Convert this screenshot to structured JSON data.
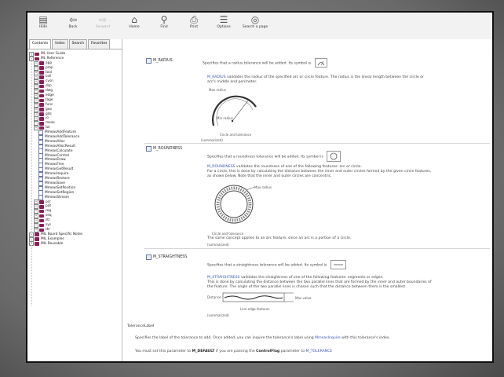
{
  "toolbar": {
    "buttons": [
      {
        "label": "Hide",
        "icon": "hide-icon"
      },
      {
        "label": "Back",
        "icon": "back-icon"
      },
      {
        "label": "Forward",
        "icon": "forward-icon"
      },
      {
        "label": "Home",
        "icon": "home-icon"
      },
      {
        "label": "Find",
        "icon": "find-icon"
      },
      {
        "label": "Print",
        "icon": "print-icon"
      },
      {
        "label": "Options",
        "icon": "options-icon"
      },
      {
        "label": "Search a page",
        "icon": "search-page-icon"
      }
    ]
  },
  "sidebar": {
    "tabs": [
      "Contents",
      "Index",
      "Search",
      "Favorites"
    ],
    "active_tab": "Contents",
    "tree": [
      {
        "label": "ML User Guide",
        "kind": "book",
        "depth": 0
      },
      {
        "label": "ML Reference",
        "kind": "book",
        "depth": 0
      },
      {
        "label": "app",
        "kind": "book",
        "depth": 1
      },
      {
        "label": "prop",
        "kind": "book",
        "depth": 1
      },
      {
        "label": "tool",
        "kind": "book",
        "depth": 1
      },
      {
        "label": "cell",
        "kind": "book",
        "depth": 1
      },
      {
        "label": "cvsn",
        "kind": "book",
        "depth": 1
      },
      {
        "label": "dsp",
        "kind": "book",
        "depth": 1
      },
      {
        "label": "dwg",
        "kind": "book",
        "depth": 1
      },
      {
        "label": "edge",
        "kind": "book",
        "depth": 1
      },
      {
        "label": "fage",
        "kind": "book",
        "depth": 1
      },
      {
        "label": "func",
        "kind": "book",
        "depth": 1
      },
      {
        "label": "geo",
        "kind": "book",
        "depth": 1
      },
      {
        "label": "gds",
        "kind": "book",
        "depth": 1
      },
      {
        "label": "io",
        "kind": "book",
        "depth": 1
      },
      {
        "label": "meas",
        "kind": "book",
        "depth": 1
      },
      {
        "label": "tol",
        "kind": "book",
        "depth": 1
      },
      {
        "label": "MmeasAddFeature",
        "kind": "page",
        "depth": 2
      },
      {
        "label": "MmeasAddTolerance",
        "kind": "page",
        "depth": 2
      },
      {
        "label": "MmeasAlloc",
        "kind": "page",
        "depth": 2
      },
      {
        "label": "MmeasAllocResult",
        "kind": "page",
        "depth": 2
      },
      {
        "label": "MmeasCalculate",
        "kind": "page",
        "depth": 2
      },
      {
        "label": "MmeasControl",
        "kind": "page",
        "depth": 2
      },
      {
        "label": "MmeasDraw",
        "kind": "page",
        "depth": 2
      },
      {
        "label": "MmeasFree",
        "kind": "page",
        "depth": 2
      },
      {
        "label": "MmeasGetResult",
        "kind": "page",
        "depth": 2
      },
      {
        "label": "MmeasInquire",
        "kind": "page",
        "depth": 2
      },
      {
        "label": "MmeasRestore",
        "kind": "page",
        "depth": 2
      },
      {
        "label": "MmeasSave",
        "kind": "page",
        "depth": 2
      },
      {
        "label": "MmeasSetPosition",
        "kind": "page",
        "depth": 2
      },
      {
        "label": "MmeasSetRegion",
        "kind": "page",
        "depth": 2
      },
      {
        "label": "MmeasStream",
        "kind": "page",
        "depth": 2
      },
      {
        "label": "ocr",
        "kind": "book",
        "depth": 1
      },
      {
        "label": "pat",
        "kind": "book",
        "depth": 1
      },
      {
        "label": "reg",
        "kind": "book",
        "depth": 1
      },
      {
        "label": "seq",
        "kind": "book",
        "depth": 1
      },
      {
        "label": "str",
        "kind": "book",
        "depth": 1
      },
      {
        "label": "sys",
        "kind": "book",
        "depth": 1
      },
      {
        "label": "thr",
        "kind": "book",
        "depth": 1
      },
      {
        "label": "MIL Board Specific Notes",
        "kind": "book",
        "depth": 0
      },
      {
        "label": "MIL Examples",
        "kind": "book",
        "depth": 0
      },
      {
        "label": "MIL Reusable",
        "kind": "book",
        "depth": 0
      }
    ]
  },
  "content": {
    "radius": {
      "name": "M_RADIUS",
      "intro": "Specifies that a radius tolerance will be added. Its symbol is",
      "desc_link": "M_RADIUS",
      "desc1": "validates the radius of the specified arc or circle feature. The radius is the linear length between the circle or",
      "desc2": "arc's middle and perimeter.",
      "fig_label_top": "Max radius",
      "fig_label_min": "Min radius",
      "fig_label_bottom": "Circle and tolerance",
      "footer": "(summarized)"
    },
    "roundness": {
      "name": "M_ROUNDNESS",
      "intro": "Specifies that a roundness tolerance will be added. Its symbol is",
      "desc_link": "M_ROUNDNESS",
      "desc1": "validates the roundness of one of the following features: arc or circle.",
      "desc2": "For a circle, this is done by calculating the distance between the inner and outer circles formed by the given circle features,",
      "desc3": "as shown below. Note that the inner and outer circles are concentric.",
      "fig_label_right": "Max radius",
      "fig_label_bottom": "Circle and tolerance",
      "desc4": "The same concept applies to an arc feature, since an arc is a portion of a circle.",
      "footer": "(summarized)"
    },
    "straightness": {
      "name": "M_STRAIGHTNESS",
      "intro": "Specifies that a straightness tolerance will be added. Its symbol is",
      "desc_link": "M_STRAIGHTNESS",
      "desc1": "validates the straightness of one of the following features: segments or edges.",
      "desc2": "This is done by calculating the distance between the two parallel lines that are formed by the inner and outer boundaries of",
      "desc3": "the feature. The angle of the two parallel lines is chosen such that the distance between them is the smallest.",
      "fig_label_left": "Distance",
      "fig_label_right": "Max value",
      "fig_label_bottom": "Line edge features",
      "footer": "(summarized)"
    },
    "tolerance_label": {
      "heading": "ToleranceLabel",
      "line1_a": "Specifies the label of the tolerance to add. Once added, you can inquire the tolerance's label using",
      "line1_link1": "MmeasInquire",
      "line1_b": "with this tolerance's index.",
      "line2_a": "You must set this parameter to",
      "line2_bold": "M_DEFAULT",
      "line2_b": "if you are passing the",
      "line2_bold2": "ControlFlag",
      "line2_c": "parameter to",
      "line2_link": "M_TOLERANCE"
    }
  },
  "colors": {
    "book": "#8a1f56",
    "link": "#3a56b4"
  }
}
